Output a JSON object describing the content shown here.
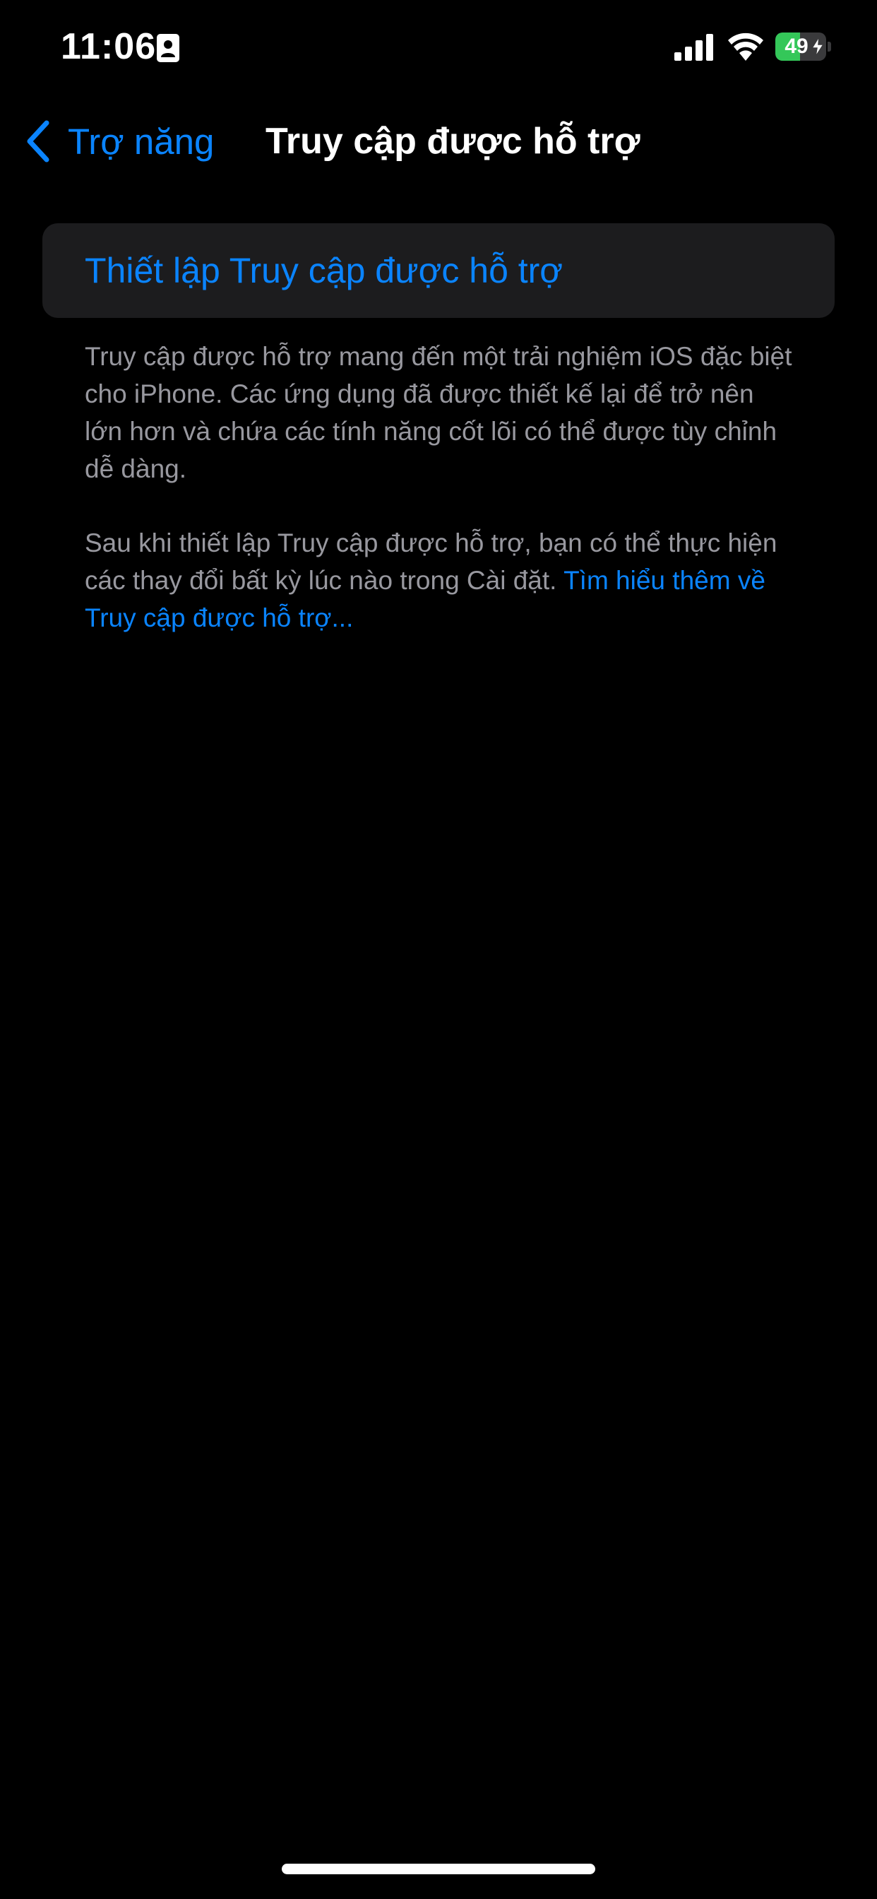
{
  "status_bar": {
    "time": "11:06",
    "battery_percent": "49",
    "battery_level": 0.49,
    "battery_color": "#34c759",
    "icons": [
      "contact-card-icon",
      "cellular-signal-icon",
      "wifi-icon",
      "battery-icon",
      "charging-bolt-icon"
    ]
  },
  "nav": {
    "back_label": "Trợ năng",
    "title": "Truy cập được hỗ trợ",
    "back_icon": "chevron-left-icon"
  },
  "content": {
    "setup_label": "Thiết lập Truy cập được hỗ trợ",
    "description": "Truy cập được hỗ trợ mang đến một trải nghiệm iOS đặc biệt cho iPhone. Các ứng dụng đã được thiết kế lại để trở nên lớn hơn và chứa các tính năng cốt lõi có thể được tùy chỉnh dễ dàng.",
    "info_text": "Sau khi thiết lập Truy cập được hỗ trợ, bạn có thể thực hiện các thay đổi bất kỳ lúc nào trong Cài đặt.",
    "learn_more": "Tìm hiểu thêm về Truy cập được hỗ trợ..."
  },
  "colors": {
    "accent": "#0a84ff",
    "background": "#000000",
    "cell_background": "#1c1c1e",
    "secondary_text": "#98989f"
  }
}
